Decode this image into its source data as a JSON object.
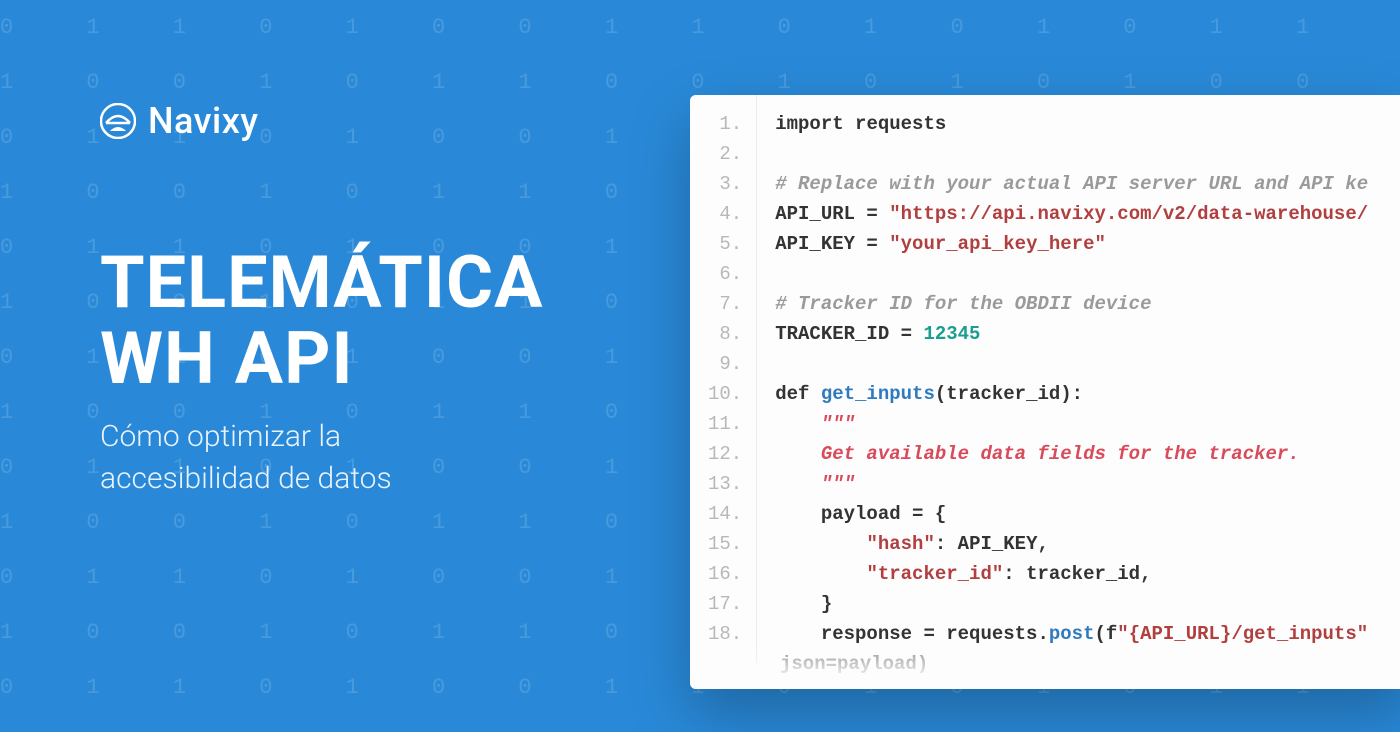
{
  "brand": {
    "name": "Navixy"
  },
  "headline": {
    "line1": "TELEMÁTICA",
    "line2": "WH API",
    "subtitle1": "Cómo optimizar la",
    "subtitle2": "accesibilidad de datos"
  },
  "code": {
    "lines": [
      {
        "n": "1.",
        "segments": [
          {
            "cls": "kw",
            "t": "import "
          },
          {
            "cls": "kw",
            "t": "requests"
          }
        ]
      },
      {
        "n": "2.",
        "segments": []
      },
      {
        "n": "3.",
        "segments": [
          {
            "cls": "comment",
            "t": "# Replace with your actual API server URL and API ke"
          }
        ]
      },
      {
        "n": "4.",
        "segments": [
          {
            "cls": "kw",
            "t": "API_URL = "
          },
          {
            "cls": "str",
            "t": "\"https://api.navixy.com/v2/data-warehouse/"
          }
        ]
      },
      {
        "n": "5.",
        "segments": [
          {
            "cls": "kw",
            "t": "API_KEY = "
          },
          {
            "cls": "str",
            "t": "\"your_api_key_here\""
          }
        ]
      },
      {
        "n": "6.",
        "segments": []
      },
      {
        "n": "7.",
        "segments": [
          {
            "cls": "comment",
            "t": "# Tracker ID for the OBDII device"
          }
        ]
      },
      {
        "n": "8.",
        "segments": [
          {
            "cls": "kw",
            "t": "TRACKER_ID = "
          },
          {
            "cls": "num",
            "t": "12345"
          }
        ]
      },
      {
        "n": "9.",
        "segments": []
      },
      {
        "n": "10.",
        "segments": [
          {
            "cls": "kw",
            "t": "def "
          },
          {
            "cls": "func",
            "t": "get_inputs"
          },
          {
            "cls": "kw",
            "t": "(tracker_id):"
          }
        ]
      },
      {
        "n": "11.",
        "segments": [
          {
            "cls": "doc",
            "t": "    \"\"\""
          }
        ]
      },
      {
        "n": "12.",
        "segments": [
          {
            "cls": "doc",
            "t": "    Get available data fields for the tracker."
          }
        ]
      },
      {
        "n": "13.",
        "segments": [
          {
            "cls": "doc",
            "t": "    \"\"\""
          }
        ]
      },
      {
        "n": "14.",
        "segments": [
          {
            "cls": "kw",
            "t": "    payload = {"
          }
        ]
      },
      {
        "n": "15.",
        "segments": [
          {
            "cls": "kw",
            "t": "        "
          },
          {
            "cls": "str",
            "t": "\"hash\""
          },
          {
            "cls": "kw",
            "t": ": API_KEY,"
          }
        ]
      },
      {
        "n": "16.",
        "segments": [
          {
            "cls": "kw",
            "t": "        "
          },
          {
            "cls": "str",
            "t": "\"tracker_id\""
          },
          {
            "cls": "kw",
            "t": ": tracker_id,"
          }
        ]
      },
      {
        "n": "17.",
        "segments": [
          {
            "cls": "kw",
            "t": "    }"
          }
        ]
      },
      {
        "n": "18.",
        "segments": [
          {
            "cls": "kw",
            "t": "    response = requests."
          },
          {
            "cls": "func",
            "t": "post"
          },
          {
            "cls": "kw",
            "t": "(f"
          },
          {
            "cls": "str",
            "t": "\"{API_URL}/get_inputs\""
          }
        ]
      }
    ],
    "truncated_tail": "json=payload)"
  },
  "binary_pattern": "0 1 1 0 1 0 0 1 1 0 1 0 1 0 1 1\n1 0 0 1 0 1 1 0 0 1 0 1 0 1 0 0\n0 1 1 0 1 0 0 1 1 0 1 0 1 0 1 1\n1 0 0 1 0 1 1 0 0 1 0 1 0 1 0 0\n0 1 1 0 1 0 0 1 1 0 1 0 1 0 1 1\n1 0 0 1 0 1 1 0 0 1 0 1 0 1 0 0\n0 1 1 0 1 0 0 1 1 0 1 0 1 0 1 1\n1 0 0 1 0 1 1 0 0 1 0 1 0 1 0 0\n0 1 1 0 1 0 0 1 1 0 1 0 1 0 1 1\n1 0 0 1 0 1 1 0 0 1 0 1 0 1 0 0\n0 1 1 0 1 0 0 1 1 0 1 0 1 0 1 1\n1 0 0 1 0 1 1 0 0 1 0 1 0 1 0 0\n0 1 1 0 1 0 0 1 1 0 1 0 1 0 1 1\n1 0 0 1 0 1 1 0 0 1 0 1 0 1 0 0"
}
